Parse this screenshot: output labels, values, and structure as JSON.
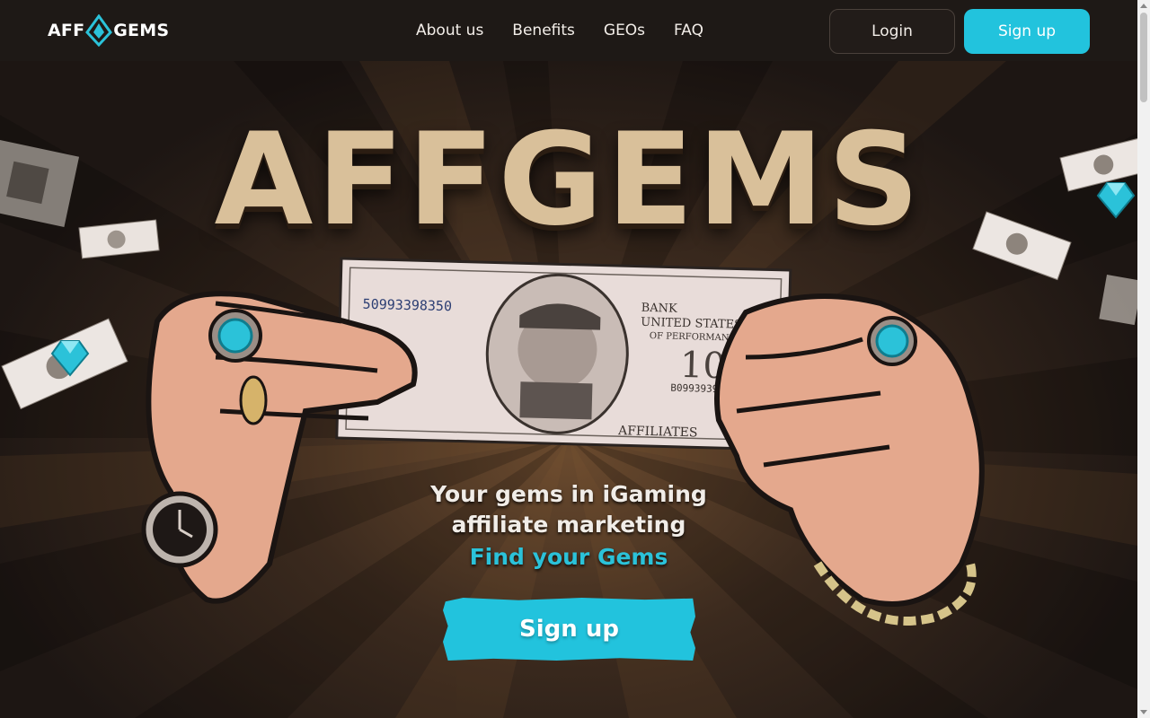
{
  "header": {
    "logo": {
      "left": "AFF",
      "right": "GEMS",
      "icon": "diamond-logo-icon"
    },
    "nav": [
      {
        "label": "About us"
      },
      {
        "label": "Benefits"
      },
      {
        "label": "GEOs"
      },
      {
        "label": "FAQ"
      }
    ],
    "login_label": "Login",
    "signup_label": "Sign up"
  },
  "hero": {
    "title": "AFFGEMS",
    "tagline_line1": "Your gems in iGaming",
    "tagline_line2": "affiliate marketing",
    "tagline_accent": "Find your Gems",
    "cta_label": "Sign up",
    "banknote": {
      "serial": "50993398350",
      "serial_short": "B09939398",
      "bank_line1": "BANK",
      "bank_line2": "UNITED STATES",
      "bank_line3": "OF PERFORMANCE",
      "denomination": "100",
      "bottom_label": "AFFILIATES"
    }
  },
  "colors": {
    "accent": "#22c3dd",
    "background": "#1c1512",
    "title": "#d9c09a"
  }
}
